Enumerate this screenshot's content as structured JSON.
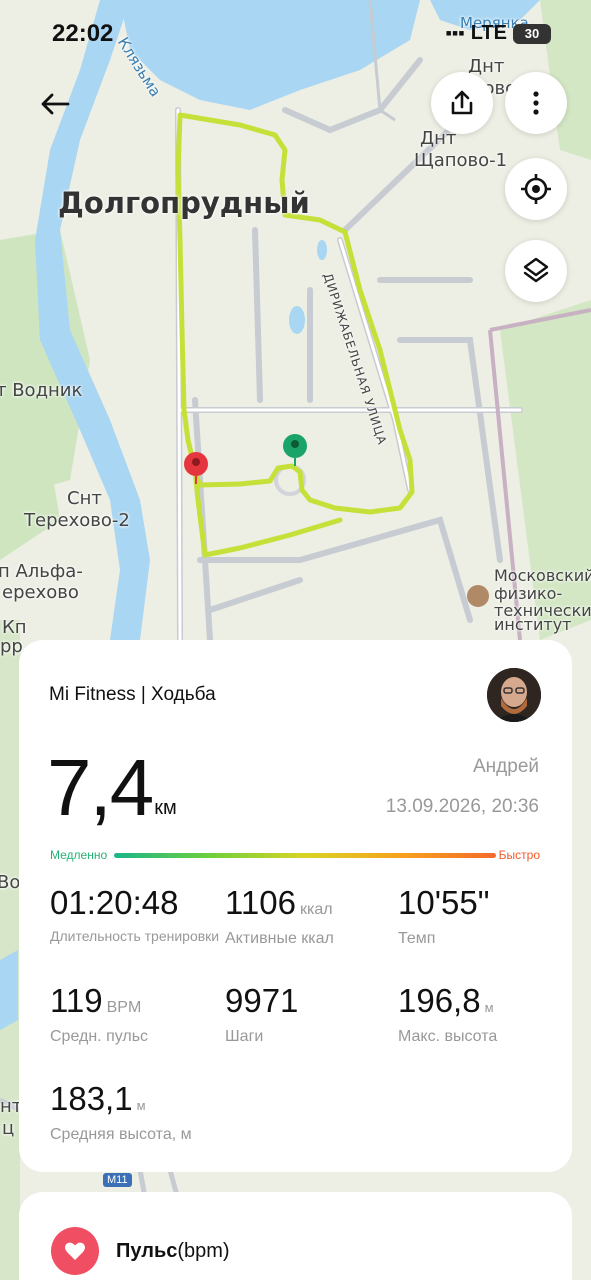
{
  "status_bar": {
    "time": "22:02",
    "network": "LTE",
    "battery": "30"
  },
  "map": {
    "labels": {
      "city": "Долгопрудный",
      "river": "Клязьма",
      "lake": "Мерянка",
      "dnt1": "Днт",
      "dnt1b": "Новое",
      "dnt2": "Днт",
      "shchapovo": "Щапово-1",
      "street": "ДИРИЖАБЕЛЬНАЯ УЛИЦА",
      "vodnik": "т Водник",
      "snt": "Снт",
      "terekhovo": "Терехово-2",
      "kp_alfa": "п Альфа-",
      "erekhovo": "ерехово",
      "kp": "Кп",
      "kp2": "рр",
      "mipt1": "Московский",
      "mipt2": "физико-",
      "mipt3": "технический",
      "mipt4": "институт",
      "road_badge": "M11",
      "edge_vo": "Во",
      "edge_nt": "нт",
      "edge_ts": "ц"
    },
    "route_color": "#c6e03a",
    "start_marker_color": "#1aa46a",
    "end_marker_color": "#e5363f"
  },
  "controls": {
    "back_icon": "arrow-left-icon",
    "share_icon": "share-icon",
    "more_icon": "more-vertical-icon",
    "locate_icon": "locate-icon",
    "layers_icon": "layers-icon"
  },
  "workout": {
    "app_title": "Mi Fitness | Ходьба",
    "distance_value": "7,4",
    "distance_unit": "км",
    "user_name": "Андрей",
    "datetime": "13.09.2026, 20:36",
    "pace_slow_label": "Медленно",
    "pace_fast_label": "Быстро",
    "stats": [
      {
        "value": "01:20:48",
        "unit": "",
        "label": "Длительность тренировки"
      },
      {
        "value": "1106",
        "unit": "ккал",
        "label": "Активные ккал"
      },
      {
        "value": "10'55\"",
        "unit": "",
        "label": "Темп"
      },
      {
        "value": "119",
        "unit": "BPM",
        "label": "Средн. пульс"
      },
      {
        "value": "9971",
        "unit": "",
        "label": "Шаги"
      },
      {
        "value": "196,8",
        "unit": "м",
        "label": "Макс. высота"
      },
      {
        "value": "183,1",
        "unit": "м",
        "label": "Средняя высота, м"
      }
    ]
  },
  "pulse_card": {
    "title_bold": "Пульс",
    "title_unit": "(bpm)",
    "icon": "heart-icon"
  }
}
